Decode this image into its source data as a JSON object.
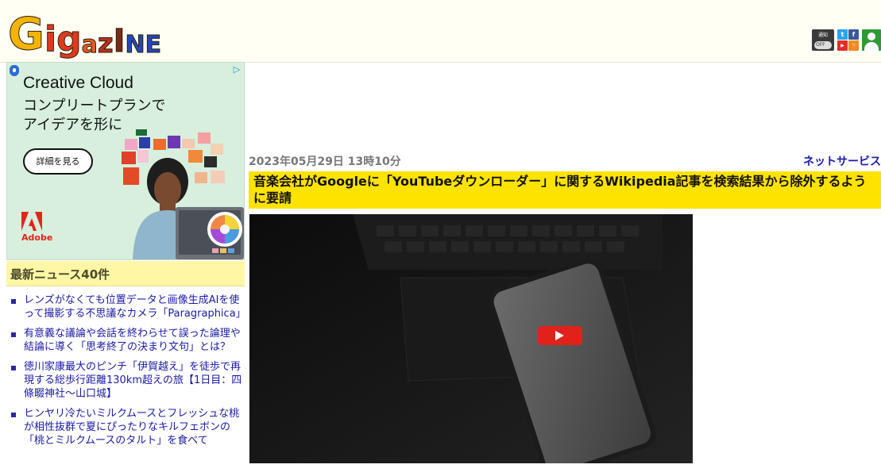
{
  "site": {
    "logo_text": "GigazINE",
    "logo_letters": [
      "G",
      "i",
      "g",
      "a",
      "z",
      "I",
      "N",
      "E"
    ]
  },
  "header": {
    "notification": {
      "label": "通知",
      "toggle": "OFF"
    },
    "social": [
      "twitter-icon",
      "facebook-icon",
      "youtube-icon",
      "rss-icon"
    ],
    "user_icon": "user-icon"
  },
  "ad": {
    "title": "Creative Cloud",
    "line1": "コンプリートプランで",
    "line2": "アイデアを形に",
    "button": "詳細を見る",
    "brand": "Adobe",
    "colors": {
      "background": "#d7efdc",
      "brand": "#e1251b"
    }
  },
  "sidebar": {
    "news_heading": "最新ニュース40件",
    "items": [
      {
        "label": "レンズがなくても位置データと画像生成AIを使って撮影する不思議なカメラ「Paragraphica」"
      },
      {
        "label": "有意義な議論や会話を終わらせて誤った論理や結論に導く「思考終了の決まり文句」とは？"
      },
      {
        "label": "徳川家康最大のピンチ「伊賀越え」を徒歩で再現する総歩行距離130km超えの旅【1日目：四條畷神社〜山口城】"
      },
      {
        "label": "ヒンヤリ冷たいミルクムースとフレッシュな桃が相性抜群で夏にぴったりなキルフェボンの「桃とミルクムースのタルト」を食べて"
      }
    ]
  },
  "article": {
    "date": "2023年05月29日 13時10分",
    "category": "ネットサービス",
    "title": "音楽会社がGoogleに「YouTubeダウンローダー」に関するWikipedia記事を検索結果から除外するように要請",
    "image_icon": "youtube-play-icon",
    "colors": {
      "title_bg": "#ffe300",
      "link": "#1a1aa6"
    }
  }
}
